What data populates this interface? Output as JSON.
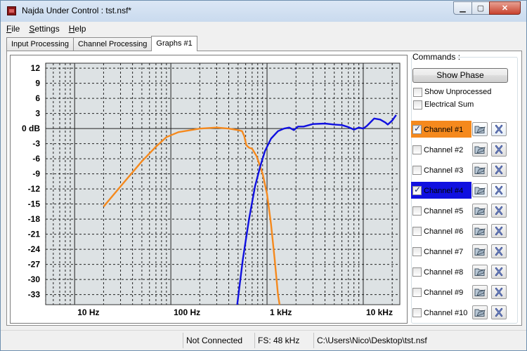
{
  "window": {
    "title": "Najda Under Control : tst.nsf*",
    "controls": {
      "minimize": "▁",
      "maximize": "▢",
      "close": "✕"
    }
  },
  "menu": [
    "File",
    "Settings",
    "Help"
  ],
  "tabs": [
    {
      "label": "Input Processing",
      "active": false
    },
    {
      "label": "Channel Processing",
      "active": false
    },
    {
      "label": "Graphs #1",
      "active": true
    }
  ],
  "commands": {
    "label": "Commands :",
    "show_phase": "Show Phase",
    "show_unprocessed": {
      "label": "Show Unprocessed",
      "checked": false
    },
    "electrical_sum": {
      "label": "Electrical Sum",
      "checked": false
    }
  },
  "channels": [
    {
      "label": "Channel #1",
      "checked": true,
      "highlight": "#f5891d"
    },
    {
      "label": "Channel #2",
      "checked": false,
      "highlight": ""
    },
    {
      "label": "Channel #3",
      "checked": false,
      "highlight": ""
    },
    {
      "label": "Channel #4",
      "checked": true,
      "highlight": "#1010e0"
    },
    {
      "label": "Channel #5",
      "checked": false,
      "highlight": ""
    },
    {
      "label": "Channel #6",
      "checked": false,
      "highlight": ""
    },
    {
      "label": "Channel #7",
      "checked": false,
      "highlight": ""
    },
    {
      "label": "Channel #8",
      "checked": false,
      "highlight": ""
    },
    {
      "label": "Channel #9",
      "checked": false,
      "highlight": ""
    },
    {
      "label": "Channel #10",
      "checked": false,
      "highlight": ""
    }
  ],
  "status": {
    "connection": "Not Connected",
    "sample_rate": "FS: 48 kHz",
    "file_path": "C:\\Users\\Nico\\Desktop\\tst.nsf"
  },
  "colors": {
    "plot_bg": "#dde2e4",
    "channel1": "#f5891d",
    "channel4": "#1010e0",
    "grid": "#222222"
  },
  "icons": {
    "edit": "folder-edit-icon",
    "mute": "x-mute-icon"
  },
  "chart_data": {
    "type": "line",
    "x_scale": "log",
    "xlim": [
      5,
      24000
    ],
    "ylim": [
      -35,
      13
    ],
    "y_ticks": [
      12,
      9,
      6,
      3,
      0,
      -3,
      -6,
      -9,
      -12,
      -15,
      -18,
      -21,
      -24,
      -27,
      -30,
      -33
    ],
    "y_tick_labels": [
      "12",
      "9",
      "6",
      "3",
      "0 dB",
      "-3",
      "-6",
      "-9",
      "-12",
      "-15",
      "-18",
      "-21",
      "-24",
      "-27",
      "-30",
      "-33"
    ],
    "x_ticks": [
      10,
      100,
      1000,
      10000
    ],
    "x_tick_labels": [
      "10 Hz",
      "100 Hz",
      "1 kHz",
      "10 kHz"
    ],
    "grid": true,
    "series": [
      {
        "name": "Channel #1",
        "color": "#f5891d",
        "points": [
          [
            20,
            -15.5
          ],
          [
            30,
            -11.5
          ],
          [
            50,
            -6.5
          ],
          [
            70,
            -3.6
          ],
          [
            90,
            -1.7
          ],
          [
            120,
            -0.7
          ],
          [
            200,
            0.0
          ],
          [
            300,
            0.2
          ],
          [
            400,
            0.0
          ],
          [
            500,
            -0.3
          ],
          [
            550,
            -0.5
          ],
          [
            580,
            -1.5
          ],
          [
            610,
            -3.3
          ],
          [
            650,
            -3.8
          ],
          [
            700,
            -4.0
          ],
          [
            780,
            -5.5
          ],
          [
            900,
            -9.0
          ],
          [
            1000,
            -13.0
          ],
          [
            1100,
            -19.0
          ],
          [
            1200,
            -26.0
          ],
          [
            1300,
            -33.0
          ],
          [
            1350,
            -35.0
          ]
        ]
      },
      {
        "name": "Channel #4",
        "color": "#1010e0",
        "points": [
          [
            490,
            -35.0
          ],
          [
            560,
            -26.0
          ],
          [
            650,
            -18.0
          ],
          [
            750,
            -11.5
          ],
          [
            850,
            -7.5
          ],
          [
            950,
            -4.5
          ],
          [
            1100,
            -2.0
          ],
          [
            1300,
            -0.5
          ],
          [
            1500,
            0.0
          ],
          [
            1700,
            0.2
          ],
          [
            1900,
            -0.3
          ],
          [
            2100,
            0.4
          ],
          [
            2400,
            0.4
          ],
          [
            3000,
            0.9
          ],
          [
            4000,
            1.0
          ],
          [
            5000,
            0.8
          ],
          [
            6000,
            0.7
          ],
          [
            7000,
            0.3
          ],
          [
            8000,
            -0.2
          ],
          [
            9000,
            0.2
          ],
          [
            10000,
            0.0
          ],
          [
            11000,
            0.6
          ],
          [
            13000,
            2.0
          ],
          [
            15000,
            1.8
          ],
          [
            17000,
            1.2
          ],
          [
            18000,
            0.8
          ],
          [
            20000,
            1.6
          ],
          [
            22000,
            2.7
          ]
        ]
      }
    ]
  }
}
